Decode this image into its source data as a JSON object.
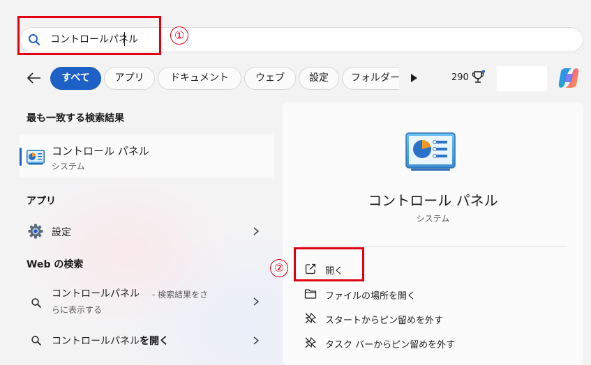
{
  "search": {
    "value": "コントロールパネル"
  },
  "annotations": {
    "step1": "①",
    "step2": "②"
  },
  "filters": {
    "chips": [
      "すべて",
      "アプリ",
      "ドキュメント",
      "ウェブ",
      "設定",
      "フォルダー"
    ],
    "active": "すべて",
    "points": "290"
  },
  "best_match": {
    "title": "最も一致する検索結果",
    "name": "コントロール パネル",
    "subtitle": "システム"
  },
  "apps": {
    "title": "アプリ",
    "items": [
      {
        "label": "設定",
        "icon": "gear-icon"
      }
    ]
  },
  "web": {
    "title": "Web の検索",
    "results": [
      {
        "main": "コントロールパネル",
        "suffix": " - 検索結果をさ",
        "line2": "らに表示する"
      },
      {
        "main": "コントロールパネル",
        "bold": "を開く"
      }
    ]
  },
  "detail": {
    "name": "コントロール パネル",
    "subtitle": "システム",
    "actions": [
      {
        "label": "開く",
        "icon": "open-external-icon"
      },
      {
        "label": "ファイルの場所を開く",
        "icon": "folder-icon"
      },
      {
        "label": "スタートからピン留めを外す",
        "icon": "unpin-icon"
      },
      {
        "label": "タスク バーからピン留めを外す",
        "icon": "unpin-icon"
      }
    ]
  },
  "colors": {
    "accent": "#1d60c6",
    "annotation": "#e00012"
  }
}
